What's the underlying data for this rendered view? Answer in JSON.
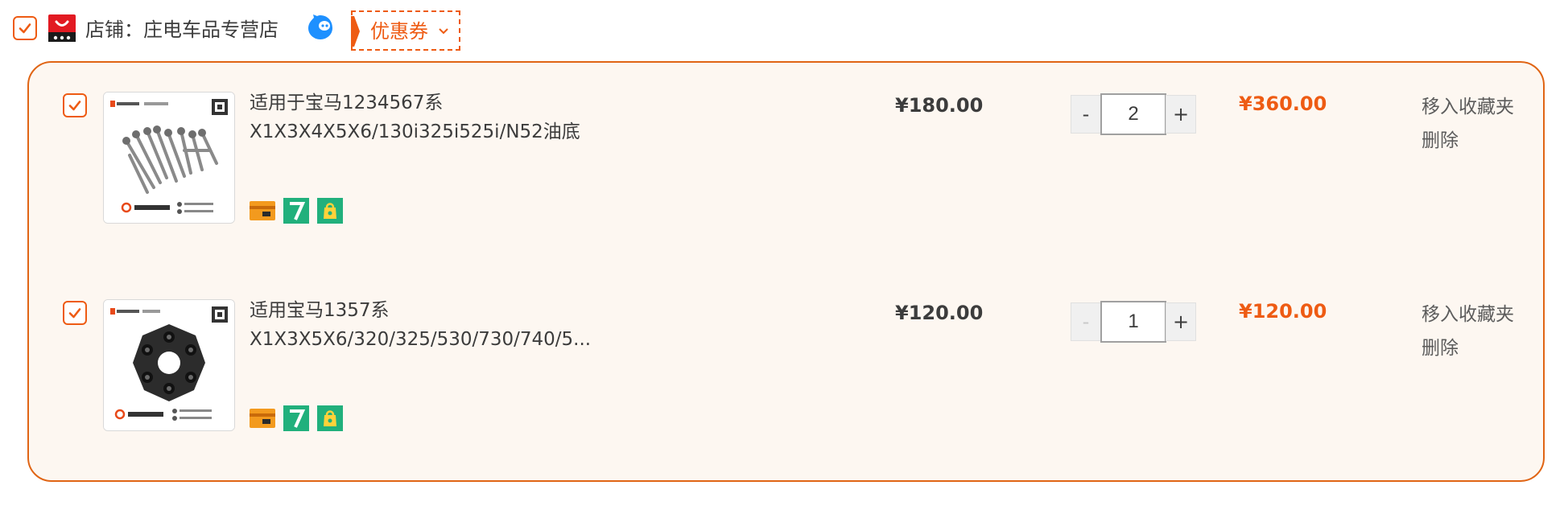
{
  "colors": {
    "accent": "#ee5b13",
    "panel_border": "#e06515",
    "panel_bg": "#fdf7f1",
    "text": "#3c3c3c"
  },
  "shop": {
    "label": "店铺：庄电车品专营店",
    "logo_icon": "tmall-shop-icon",
    "chat_icon": "aliwangwang-chat-icon",
    "coupon_label": "优惠券",
    "coupon_chevron_icon": "chevron-down-icon",
    "selected": true
  },
  "items": [
    {
      "selected": true,
      "title_line1": "适用于宝马1234567系",
      "title_line2": "X1X3X4X5X6/130i325i525i/N52油底",
      "thumbnail": "bolt-set-product-image",
      "service_icons": [
        "credit-card-icon",
        "seven-day-return-icon",
        "shopping-bag-icon"
      ],
      "unit_price": "¥180.00",
      "quantity": "2",
      "minus_label": "-",
      "plus_label": "+",
      "minus_disabled": false,
      "subtotal": "¥360.00",
      "op_favorite": "移入收藏夹",
      "op_delete": "删除"
    },
    {
      "selected": true,
      "title_line1": "适用宝马1357系",
      "title_line2": "X1X3X5X6/320/325/530/730/740/5...",
      "thumbnail": "flex-disc-coupling-product-image",
      "service_icons": [
        "credit-card-icon",
        "seven-day-return-icon",
        "shopping-bag-icon"
      ],
      "unit_price": "¥120.00",
      "quantity": "1",
      "minus_label": "-",
      "plus_label": "+",
      "minus_disabled": true,
      "subtotal": "¥120.00",
      "op_favorite": "移入收藏夹",
      "op_delete": "删除"
    }
  ]
}
